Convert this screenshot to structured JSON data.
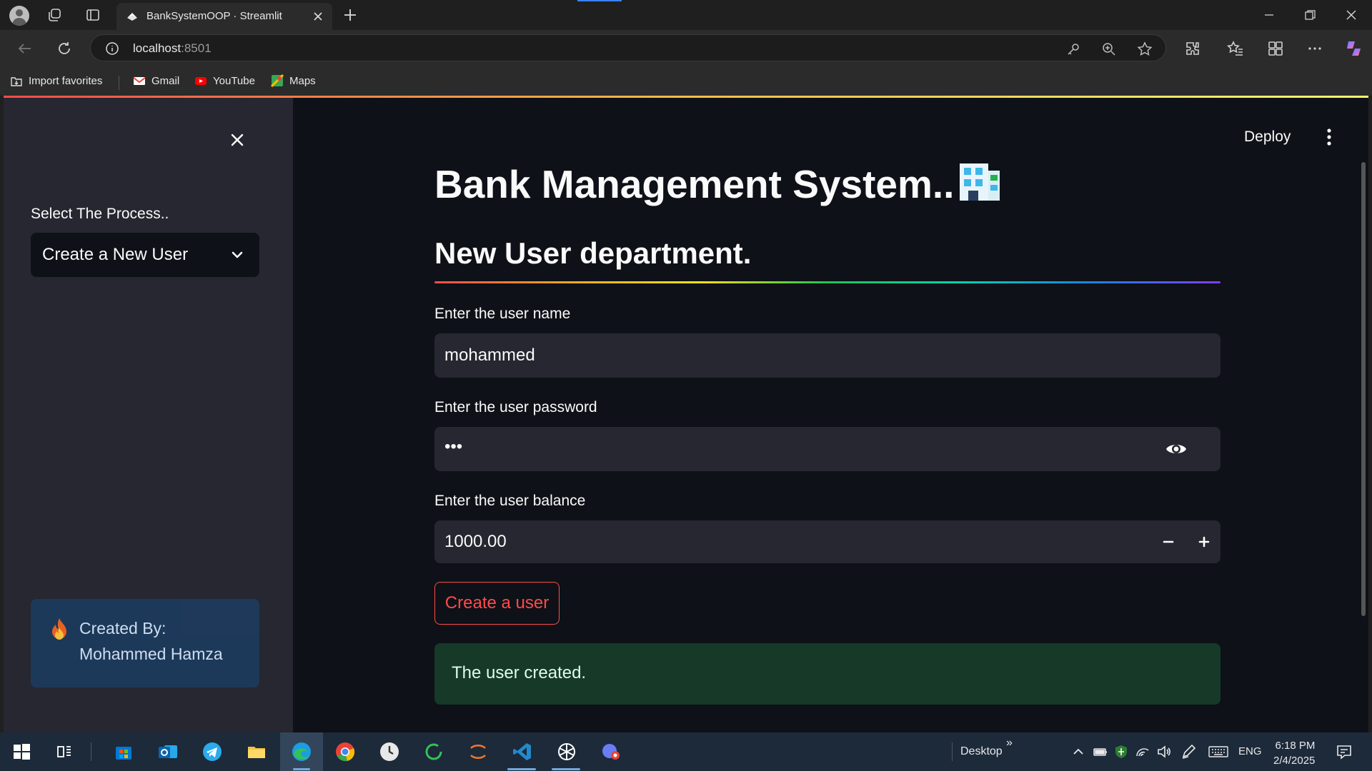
{
  "browser": {
    "tab_title": "BankSystemOOP · Streamlit",
    "address_host": "localhost",
    "address_port": ":8501",
    "bookmarks": [
      {
        "label": "Import favorites",
        "icon": "import-icon"
      },
      {
        "label": "Gmail",
        "icon": "gmail-icon"
      },
      {
        "label": "YouTube",
        "icon": "youtube-icon"
      },
      {
        "label": "Maps",
        "icon": "maps-icon"
      }
    ]
  },
  "sidebar": {
    "select_label": "Select The Process..",
    "select_value": "Create a New User",
    "credit_line1": "Created By:",
    "credit_line2": "Mohammed Hamza",
    "credit_icon": "fire-icon"
  },
  "header": {
    "deploy_label": "Deploy"
  },
  "main": {
    "title": "Bank Management System..",
    "title_icon": "office-building-icon",
    "subtitle": "New User department.",
    "fields": {
      "name_label": "Enter the user name",
      "name_value": "mohammed",
      "password_label": "Enter the user password",
      "password_value": "•••",
      "balance_label": "Enter the user balance",
      "balance_value": "1000.00"
    },
    "button_label": "Create a user",
    "success_message": "The user created."
  },
  "taskbar": {
    "desktop_label": "Desktop",
    "more_label": "»",
    "language": "ENG",
    "time": "6:18 PM",
    "date": "2/4/2025"
  },
  "colors": {
    "app_bg": "#0e1117",
    "sidebar_bg": "#262730",
    "primary": "#ff4b4b",
    "success_bg": "#173928",
    "info_bg": "#1d3a5c"
  }
}
